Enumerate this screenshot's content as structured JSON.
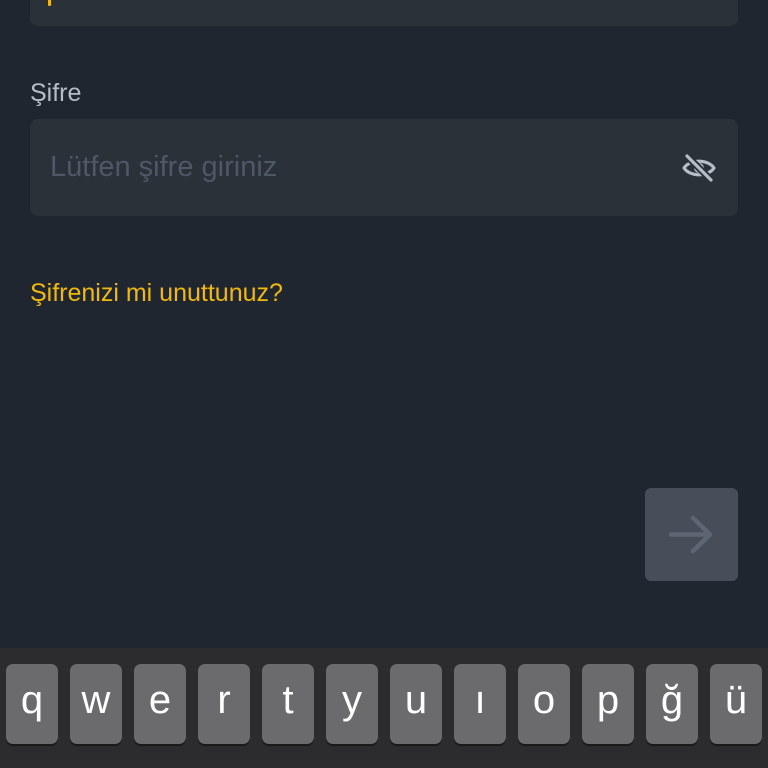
{
  "password_field": {
    "label": "Şifre",
    "placeholder": "Lütfen şifre giriniz",
    "value": ""
  },
  "forgot_link": "Şifrenizi mi unuttunuz?",
  "icons": {
    "visibility_toggle": "eye-off-icon",
    "submit": "arrow-right-icon"
  },
  "keyboard": {
    "row1": [
      "q",
      "w",
      "e",
      "r",
      "t",
      "y",
      "u",
      "ı",
      "o",
      "p",
      "ğ",
      "ü"
    ]
  },
  "colors": {
    "background": "#1f2630",
    "input_background": "#2b3139",
    "accent": "#f0b90b",
    "label": "#b7bdc6",
    "placeholder": "#4f5866",
    "button_disabled": "#474e5a",
    "keyboard_background": "#2c2c2e",
    "key_background": "#6b6b6e"
  }
}
